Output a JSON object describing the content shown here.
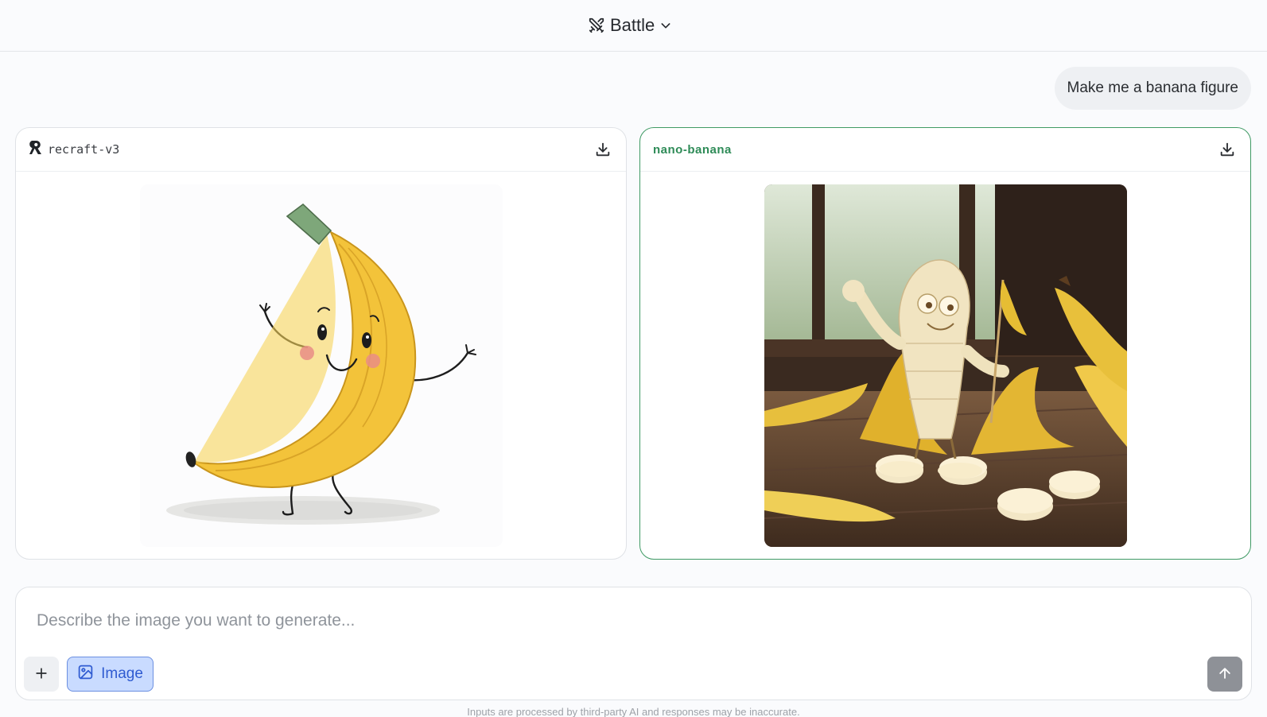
{
  "header": {
    "mode_label": "Battle",
    "mode_icon": "swords-icon",
    "dropdown_icon": "chevron-down-icon"
  },
  "conversation": {
    "user_message": "Make me a banana figure"
  },
  "responses": [
    {
      "model": "recraft-v3",
      "logo_icon": "recraft-logo-icon",
      "download_icon": "download-icon",
      "image_subject": "cartoon-banana"
    },
    {
      "model": "nano-banana",
      "download_icon": "download-icon",
      "image_subject": "photo-banana-figure",
      "accent": "#2e8b57"
    }
  ],
  "composer": {
    "placeholder": "Describe the image you want to generate...",
    "add_icon": "plus-icon",
    "image_mode_label": "Image",
    "image_mode_icon": "image-icon",
    "send_icon": "arrow-up-icon"
  },
  "footer": {
    "disclaimer": "Inputs are processed by third-party AI and responses may be inaccurate."
  },
  "colors": {
    "page_bg": "#fafbfd",
    "selected_border": "#3f9a64",
    "image_chip_bg": "#c9dbff",
    "image_chip_text": "#2f5bd1",
    "send_bg": "#8e9197"
  }
}
